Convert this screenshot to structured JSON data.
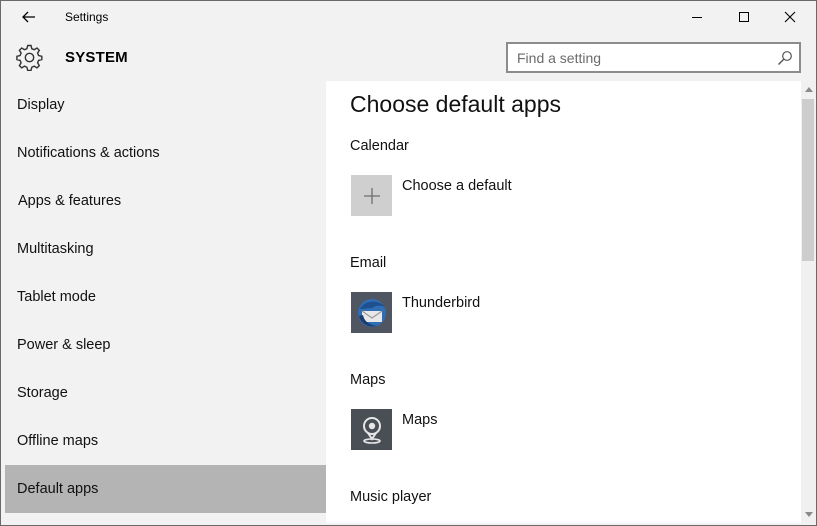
{
  "window": {
    "title": "Settings"
  },
  "header": {
    "section_title": "SYSTEM",
    "search_placeholder": "Find a setting"
  },
  "sidebar": {
    "items": [
      {
        "label": "Display",
        "selected": false
      },
      {
        "label": "Notifications & actions",
        "selected": false
      },
      {
        "label": "Apps & features",
        "selected": false
      },
      {
        "label": "Multitasking",
        "selected": false
      },
      {
        "label": "Tablet mode",
        "selected": false
      },
      {
        "label": "Power & sleep",
        "selected": false
      },
      {
        "label": "Storage",
        "selected": false
      },
      {
        "label": "Offline maps",
        "selected": false
      },
      {
        "label": "Default apps",
        "selected": true
      }
    ]
  },
  "main": {
    "title": "Choose default apps",
    "sections": [
      {
        "label": "Calendar",
        "app": "Choose a default",
        "icon": "plus-icon"
      },
      {
        "label": "Email",
        "app": "Thunderbird",
        "icon": "thunderbird-icon"
      },
      {
        "label": "Maps",
        "app": "Maps",
        "icon": "maps-icon"
      },
      {
        "label": "Music player"
      }
    ]
  },
  "colors": {
    "selected_nav_bg": "#b4b4b4",
    "sidebar_bg": "#f2f2f2",
    "content_bg": "#ffffff"
  }
}
